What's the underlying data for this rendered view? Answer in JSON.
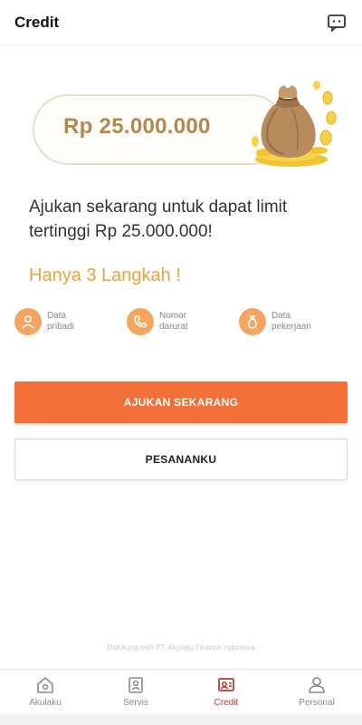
{
  "header": {
    "title": "Credit",
    "chat_icon": "chat-icon"
  },
  "banner": {
    "amount": "Rp 25.000.000",
    "image": "money-bag-with-gold-coins"
  },
  "headline": "Ajukan sekarang untuk dapat limit tertinggi Rp 25.000.000!",
  "steps_title": "Hanya 3 Langkah !",
  "steps": [
    {
      "label": "Data pribadi",
      "icon": "person-icon"
    },
    {
      "label": "Nomor darurat",
      "icon": "phone-icon"
    },
    {
      "label": "Data pekerjaan",
      "icon": "work-icon"
    }
  ],
  "primary_button": "AJUKAN SEKARANG",
  "secondary_button": "PESANANKU",
  "footer_note": "Didukung oleh PT. Akulaku Finance Indonesia",
  "tabs": [
    {
      "label": "Akulaku",
      "icon": "home-icon",
      "active": false
    },
    {
      "label": "Servis",
      "icon": "service-icon",
      "active": false
    },
    {
      "label": "Credit",
      "icon": "credit-icon",
      "active": true
    },
    {
      "label": "Personal",
      "icon": "person-icon",
      "active": false
    }
  ],
  "colors": {
    "accent": "#f27038",
    "gold_text": "#b4874e",
    "steps_title": "#e8a43a",
    "step_icon_bg": "#f4a660",
    "active_tab": "#c0392b"
  }
}
